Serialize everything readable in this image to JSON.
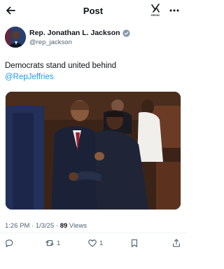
{
  "header": {
    "title": "Post",
    "grok_label": "GROK"
  },
  "author": {
    "name": "Rep. Jonathan L. Jackson",
    "handle": "@rep_jackson"
  },
  "tweet": {
    "text": "Democrats stand united behind",
    "mention": "@RepJeffries"
  },
  "meta": {
    "time": "1:26 PM · 1/3/25 · ",
    "views_count": "89",
    "views_label": " Views"
  },
  "actions": {
    "retweets": "1",
    "likes": "1"
  },
  "colors": {
    "accent": "#1d9bf0",
    "muted": "#536471",
    "text": "#0f1419"
  },
  "icons": [
    "back-arrow-icon",
    "grok-icon",
    "more-icon",
    "verified-badge-icon",
    "reply-icon",
    "retweet-icon",
    "like-icon",
    "bookmark-icon",
    "share-icon"
  ]
}
